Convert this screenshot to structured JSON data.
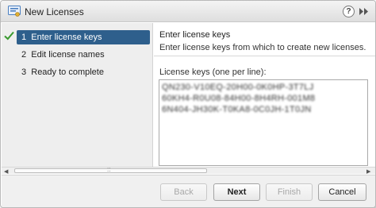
{
  "window": {
    "title": "New Licenses",
    "help_glyph": "?"
  },
  "sidebar": {
    "steps": [
      {
        "number": "1",
        "label": "Enter license keys",
        "state": "active-complete"
      },
      {
        "number": "2",
        "label": "Edit license names",
        "state": "pending"
      },
      {
        "number": "3",
        "label": "Ready to complete",
        "state": "pending"
      }
    ]
  },
  "content": {
    "title": "Enter license keys",
    "subtitle": "Enter license keys from which to create new licenses.",
    "keys_label": "License keys (one per line):",
    "keys": [
      "QN230-V10EQ-20H00-0K0HP-3T7LJ",
      "60KH4-R0U08-84H00-8H4RH-001M8",
      "6N404-JH30K-T0KA8-0C0JH-1T0JN"
    ]
  },
  "scrollbar": {
    "grip": "::"
  },
  "footer": {
    "back_label": "Back",
    "next_label": "Next",
    "finish_label": "Finish",
    "cancel_label": "Cancel"
  },
  "colors": {
    "active_step_bg": "#2e5f8c",
    "check_green": "#3a9a2f",
    "title_icon_blue": "#4a7fc0"
  }
}
